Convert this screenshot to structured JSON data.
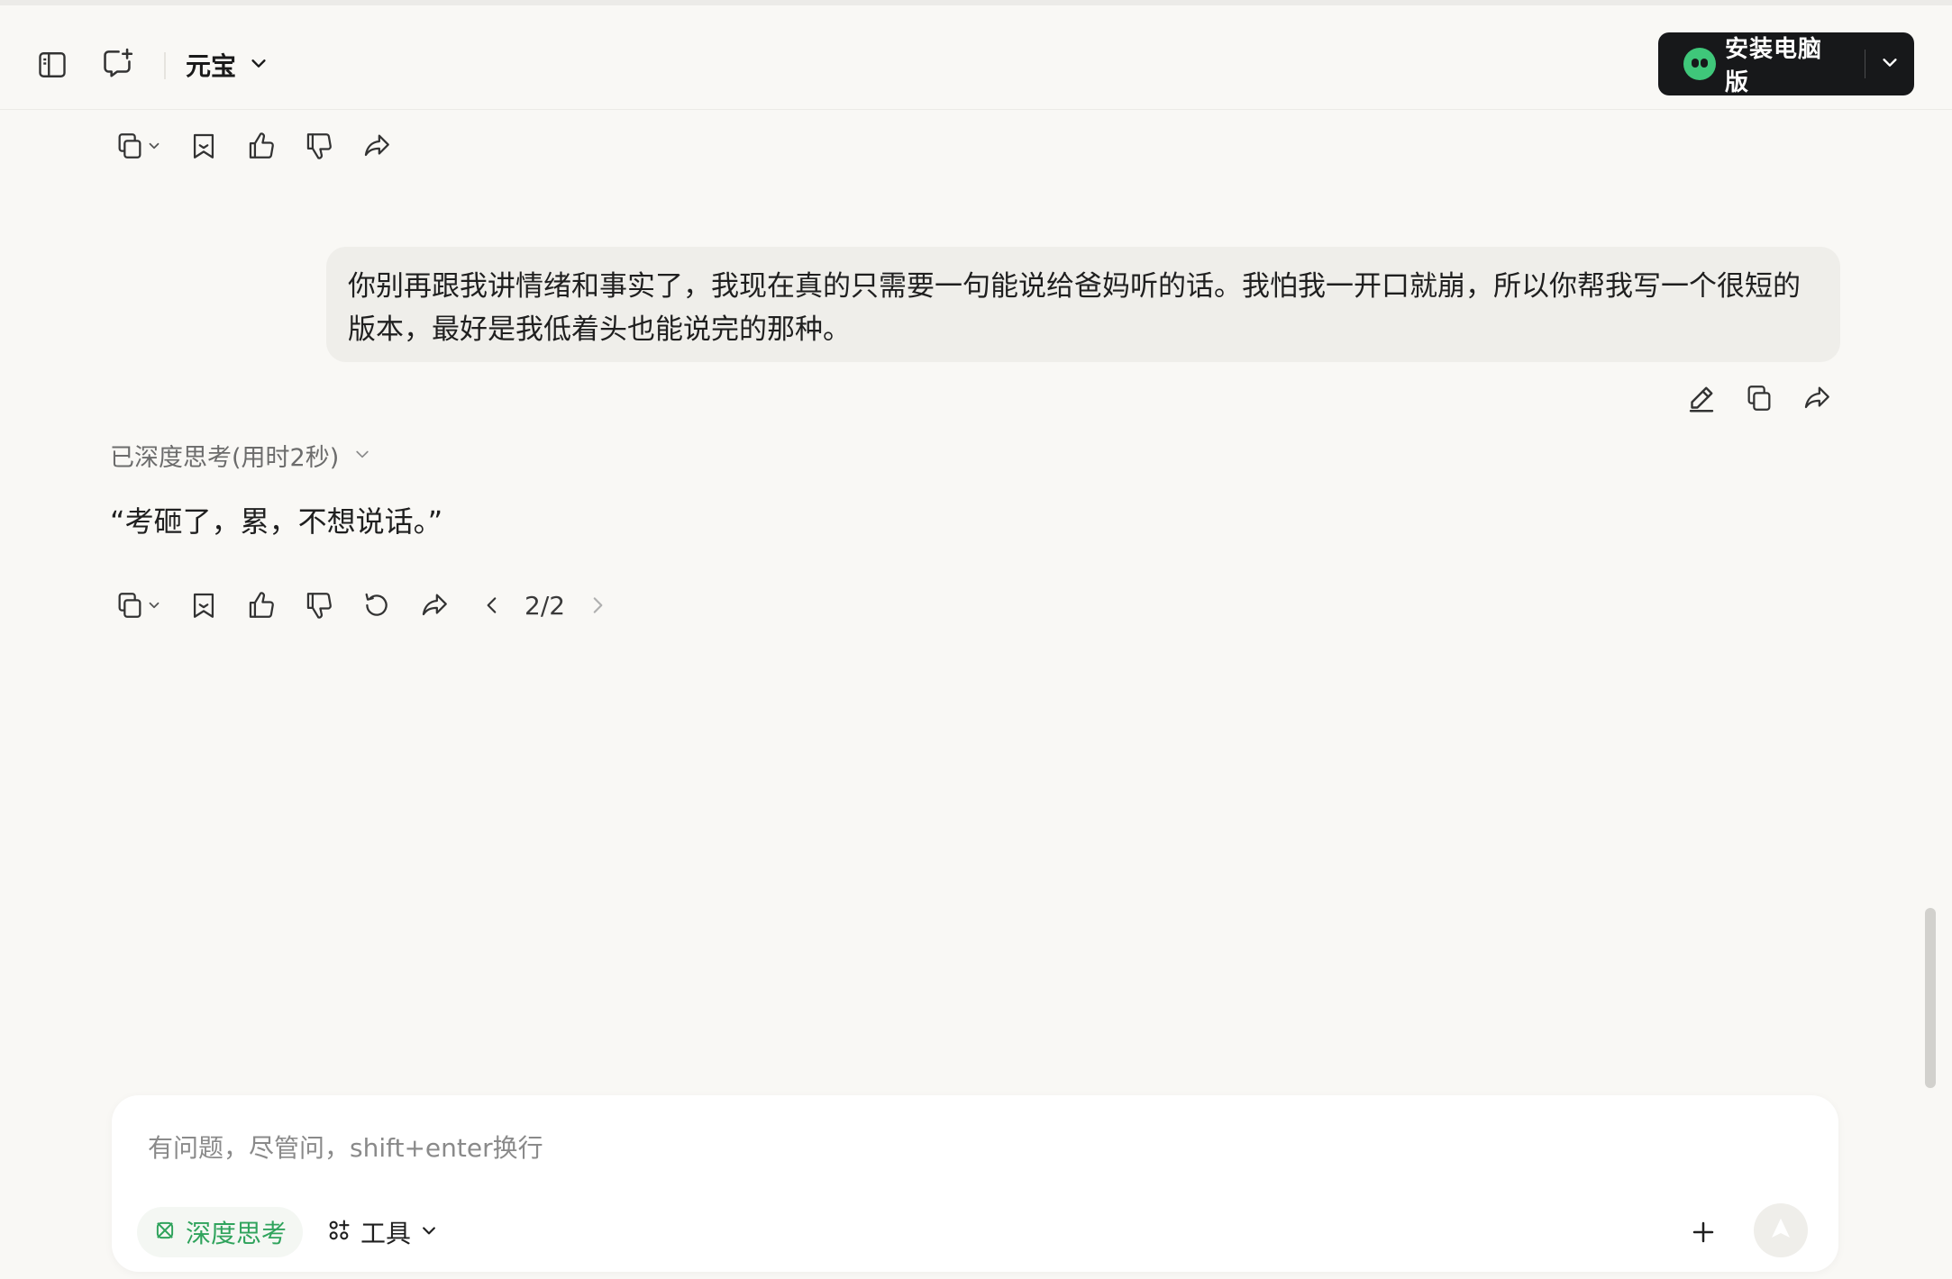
{
  "header": {
    "model_name": "元宝",
    "install_label": "安装电脑版"
  },
  "messages": {
    "user_text": "你别再跟我讲情绪和事实了，我现在真的只需要一句能说给爸妈听的话。我怕我一开口就崩，所以你帮我写一个很短的版本，最好是我低着头也能说完的那种。",
    "thinking_label": "已深度思考(用时2秒)",
    "answer_text": "“考砸了，累，不想说话。”",
    "pager": "2/2"
  },
  "composer": {
    "placeholder": "有问题，尽管问，shift+enter换行",
    "deep_think_label": "深度思考",
    "tools_label": "工具"
  },
  "colors": {
    "background": "#f9f8f5",
    "accent_green": "#2fa35c",
    "install_bg": "#17181a",
    "user_bubble": "#efeeea"
  },
  "icons": [
    "sidebar-toggle-icon",
    "new-chat-icon",
    "chevron-down-icon",
    "copy-icon",
    "bookmark-icon",
    "thumbs-up-icon",
    "thumbs-down-icon",
    "share-icon",
    "edit-icon",
    "regenerate-icon",
    "chevron-left-icon",
    "chevron-right-icon",
    "atom-icon",
    "tools-icon",
    "plus-icon",
    "send-icon"
  ]
}
